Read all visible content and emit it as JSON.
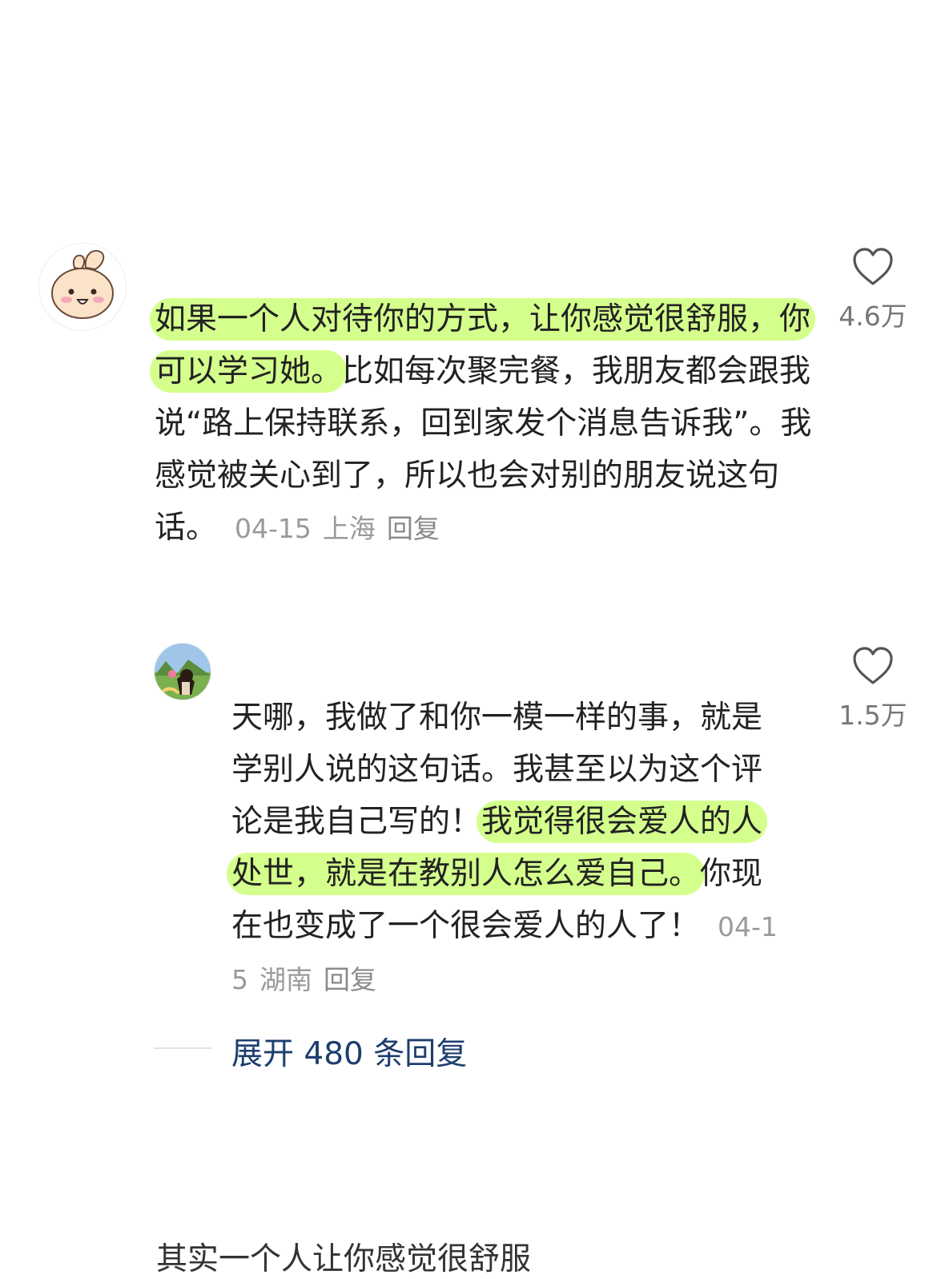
{
  "comments": [
    {
      "avatar_icon": "bunny-avatar-icon",
      "segments": [
        {
          "text": "如果一个人对待你的方式，让你感觉很舒服，你可以学习她。",
          "highlight": true
        },
        {
          "text": "比如每次聚完餐，我朋友都会跟我说“路上保持联系，回到家发个消息告诉我”。我感觉被关心到了，所以也会对别的朋友说这句话。",
          "highlight": false
        }
      ],
      "date": "04-15",
      "location": "上海",
      "reply_label": "回复",
      "likes": "4.6万",
      "like_icon": "heart-outline-icon"
    },
    {
      "avatar_icon": "girl-landscape-avatar-icon",
      "segments": [
        {
          "text": "天哪，我做了和你一模一样的事，就是学别人说的这句话。我甚至以为这个评论是我自己写的！",
          "highlight": false
        },
        {
          "text": "我觉得很会爱人的人处世，就是在教别人怎么爱自己。",
          "highlight": true
        },
        {
          "text": "你现在也变成了一个很会爱人的人了！",
          "highlight": false
        }
      ],
      "date": "04-15",
      "location": "湖南",
      "reply_label": "回复",
      "likes": "1.5万",
      "like_icon": "heart-outline-icon"
    }
  ],
  "expand_replies": {
    "label": "展开 480 条回复"
  },
  "next_comment_partial": "其实一个人让你感觉很舒服",
  "colors": {
    "highlight": "#c4ff60",
    "link": "#1d3e6e",
    "meta": "#9a9a9a"
  }
}
